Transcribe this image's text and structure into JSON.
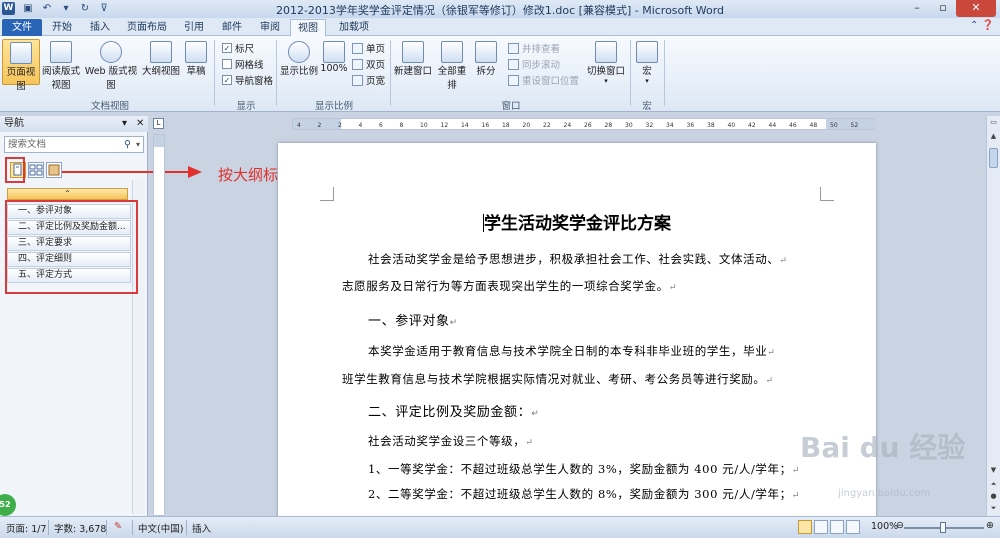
{
  "window": {
    "title": "2012-2013学年奖学金评定情况（徐银军等修订）修改1.doc [兼容模式] - Microsoft Word",
    "app_letter": "W"
  },
  "tabs": [
    {
      "label": "文件"
    },
    {
      "label": "开始"
    },
    {
      "label": "插入"
    },
    {
      "label": "页面布局"
    },
    {
      "label": "引用"
    },
    {
      "label": "邮件"
    },
    {
      "label": "审阅"
    },
    {
      "label": "视图"
    },
    {
      "label": "加载项"
    }
  ],
  "ribbon": {
    "doc_views": {
      "label": "文档视图",
      "buttons": [
        "页面视图",
        "阅读版式视图",
        "Web 版式视图",
        "大纲视图",
        "草稿"
      ]
    },
    "show": {
      "label": "显示",
      "items": [
        {
          "label": "标尺",
          "checked": true
        },
        {
          "label": "网格线",
          "checked": false
        },
        {
          "label": "导航窗格",
          "checked": true
        }
      ]
    },
    "zoom": {
      "label": "显示比例",
      "buttons": [
        "显示比例",
        "100%"
      ],
      "small": [
        "单页",
        "双页",
        "页宽"
      ]
    },
    "window": {
      "label": "窗口",
      "buttons": [
        "新建窗口",
        "全部重排",
        "拆分"
      ],
      "small": [
        "并排查看",
        "同步滚动",
        "重设窗口位置"
      ],
      "switch": "切换窗口"
    },
    "macro": {
      "label": "宏",
      "button": "宏"
    }
  },
  "nav": {
    "title": "导航",
    "search_placeholder": "搜索文档",
    "collapse_symbol": "⌃",
    "headings": [
      "一、参评对象",
      "二、评定比例及奖励金额...",
      "三、评定要求",
      "四、评定细则",
      "五、评定方式"
    ]
  },
  "annotation": {
    "text": "按大纲标题显示"
  },
  "ruler": {
    "marks": [
      "4",
      "2",
      "2",
      "4",
      "6",
      "8",
      "10",
      "12",
      "14",
      "16",
      "18",
      "20",
      "22",
      "24",
      "26",
      "28",
      "30",
      "32",
      "34",
      "36",
      "38",
      "40",
      "42",
      "44",
      "46",
      "48",
      "50",
      "52"
    ]
  },
  "document": {
    "title": "学生活动奖学金评比方案",
    "lines": [
      {
        "text": "社会活动奖学金是给予思想进步，积极承担社会工作、社会实践、文体活动、",
        "indent": true,
        "type": "body"
      },
      {
        "text": "志愿服务及日常行为等方面表现突出学生的一项综合奖学金。",
        "indent": false,
        "type": "body"
      },
      {
        "text": "一、参评对象",
        "indent": true,
        "type": "head"
      },
      {
        "text": "本奖学金适用于教育信息与技术学院全日制的本专科非毕业班的学生，毕业",
        "indent": true,
        "type": "body"
      },
      {
        "text": "班学生教育信息与技术学院根据实际情况对就业、考研、考公务员等进行奖励。",
        "indent": false,
        "type": "body"
      },
      {
        "text": "二、评定比例及奖励金额：",
        "indent": true,
        "type": "head"
      },
      {
        "text": "社会活动奖学金设三个等级，",
        "indent": true,
        "type": "body"
      },
      {
        "text": "1、一等奖学金：不超过班级总学生人数的 3%，奖励金额为 400 元/人/学年；",
        "indent": true,
        "type": "body"
      },
      {
        "text": "2、二等奖学金：不超过班级总学生人数的 8%，奖励金额为 300 元/人/学年；",
        "indent": true,
        "type": "body"
      }
    ],
    "para_mark": "↵"
  },
  "watermark": {
    "text": "Bai du 经验",
    "sub": "jingyan.baidu.com"
  },
  "status": {
    "page": "页面: 1/7",
    "words": "字数: 3,678",
    "lang": "中文(中国)",
    "mode": "插入",
    "zoom": "100%",
    "badge": "52"
  },
  "colors": {
    "annotation": "#e0312d",
    "active_view": "#f7c55b",
    "file_tab": "#2a64b6"
  }
}
